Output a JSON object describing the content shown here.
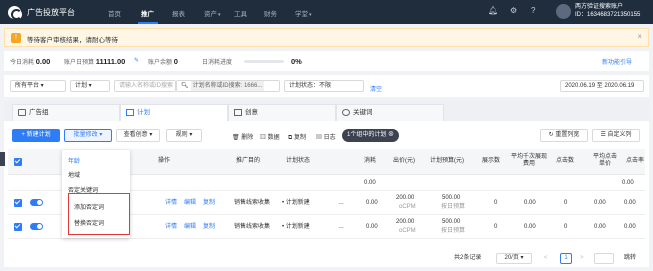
{
  "topnav": {
    "brand": "广告投放平台",
    "items": [
      {
        "label": "首页",
        "active": false
      },
      {
        "label": "推广",
        "active": true
      },
      {
        "label": "报表",
        "active": false
      },
      {
        "label": "资产",
        "active": false,
        "dropdown": true
      },
      {
        "label": "工具",
        "active": false
      },
      {
        "label": "财务",
        "active": false
      },
      {
        "label": "学堂",
        "active": false,
        "dropdown": true
      }
    ],
    "icons": [
      "bell-icon",
      "gear-icon",
      "help-icon"
    ],
    "account_name": "两方验证搜索账户",
    "account_id": "ID：1634683721350155"
  },
  "banner": {
    "icon": "warning-icon",
    "text": "等待客户审核结果，请耐心等待",
    "close": "×"
  },
  "stats": {
    "today_spend_label": "今日消耗",
    "today_spend": "0.00",
    "budget_label": "账户日预算",
    "budget": "11111.00",
    "budget_icon": "edit-icon",
    "balance_label": "账户余额",
    "balance": "0",
    "progress_label": "日消耗进度",
    "progress_value": "0%",
    "progress_fraction": 0,
    "guide_link": "新功能引导"
  },
  "filters": {
    "platform": "所有平台",
    "level": "计划",
    "search_placeholder": "请输入名称或ID搜索",
    "search_id_tag": "计划名称或ID搜索: 1666...",
    "status_prefix": "计划状态：不限",
    "clear": "清空",
    "date_range": "2020.06.19 至 2020.06.19"
  },
  "tabs": [
    {
      "label": "广告组",
      "icon": "folder-icon",
      "active": false
    },
    {
      "label": "计划",
      "icon": "doc-icon",
      "active": true
    },
    {
      "label": "创意",
      "icon": "image-icon",
      "active": false
    },
    {
      "label": "关键词",
      "icon": "key-icon",
      "active": false
    }
  ],
  "toolbar": {
    "new_plan": "+ 新建计划",
    "batch_edit": "批量修改",
    "view_creative": "查看创意",
    "rules": "规则",
    "delete": "删除",
    "data": "数据",
    "copy": "复制",
    "log": "日志",
    "selected_pill": "1个组中的计划",
    "reset_columns": "重置列宽",
    "custom_columns": "自定义列"
  },
  "dropdown": {
    "items": [
      "年龄",
      "地域",
      "否定关键词",
      "添加否定词",
      "替换否定词"
    ]
  },
  "table": {
    "headers": [
      "操作",
      "推广目的",
      "计划状态",
      "消耗",
      "出价(元)",
      "计划预算(元)",
      "展示数",
      "平均千次展现费用",
      "点击数",
      "平均点击单价",
      "点击率"
    ],
    "summary": {
      "label": "总",
      "cost": "0.00",
      "dash": "0.00"
    },
    "rows": [
      {
        "actions": [
          "详情",
          "编辑",
          "复制"
        ],
        "purpose": "销售线索收集",
        "status": "• 计划新建",
        "dots": "…",
        "cost": "0.00",
        "bid": "200.00",
        "bid_unit": "oCPM",
        "budget": "500.00",
        "budget_unit": "按日预算",
        "impr": "0",
        "cpm": "0.00",
        "clicks": "0",
        "cpc": "0.00",
        "ctr": "0.00"
      },
      {
        "actions": [
          "详情",
          "编辑",
          "复制"
        ],
        "purpose": "销售线索收集",
        "status": "• 计划新建",
        "dots": "…",
        "cost": "0.00",
        "bid": "200.00",
        "bid_unit": "oCPM",
        "budget": "500.00",
        "budget_unit": "按日预算",
        "impr": "0",
        "cpm": "0.00",
        "clicks": "0",
        "cpc": "0.00",
        "ctr": "0.00"
      }
    ]
  },
  "pager": {
    "total": "共2条记录",
    "page_size": "20/页",
    "current": "1",
    "goto": "跳转",
    "prev": "<",
    "next": ">"
  }
}
